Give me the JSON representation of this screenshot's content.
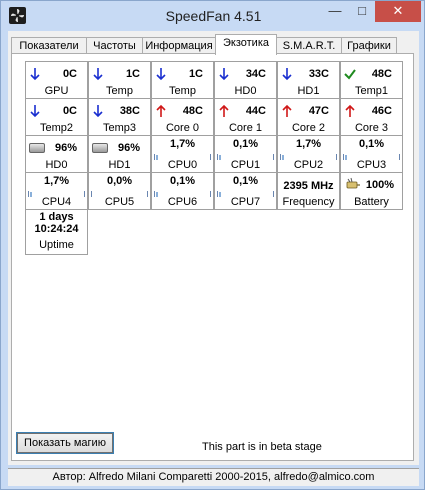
{
  "window": {
    "title": "SpeedFan 4.51",
    "minimize": "—",
    "maximize": "□",
    "close": "✕"
  },
  "tabs": [
    {
      "label": "Показатели"
    },
    {
      "label": "Частоты"
    },
    {
      "label": "Информация"
    },
    {
      "label": "Экзотика",
      "active": true
    },
    {
      "label": "S.M.A.R.T."
    },
    {
      "label": "Графики"
    }
  ],
  "sensors": {
    "gpu": {
      "value": "0C",
      "label": "GPU",
      "trend": "down"
    },
    "temp1": {
      "value": "1C",
      "label": "Temp",
      "trend": "down"
    },
    "temp2": {
      "value": "1C",
      "label": "Temp",
      "trend": "down"
    },
    "hd0": {
      "value": "34C",
      "label": "HD0",
      "trend": "down"
    },
    "hd1": {
      "value": "33C",
      "label": "HD1",
      "trend": "down"
    },
    "temp1b": {
      "value": "48C",
      "label": "Temp1",
      "trend": "ok"
    },
    "temp2b": {
      "value": "0C",
      "label": "Temp2",
      "trend": "down"
    },
    "temp3": {
      "value": "38C",
      "label": "Temp3",
      "trend": "down"
    },
    "core0": {
      "value": "48C",
      "label": "Core 0",
      "trend": "up"
    },
    "core1": {
      "value": "44C",
      "label": "Core 1",
      "trend": "up"
    },
    "core2": {
      "value": "47C",
      "label": "Core 2",
      "trend": "up"
    },
    "core3": {
      "value": "46C",
      "label": "Core 3",
      "trend": "up"
    }
  },
  "disks": {
    "hd0": {
      "value": "96%",
      "label": "HD0"
    },
    "hd1": {
      "value": "96%",
      "label": "HD1"
    }
  },
  "cpus": [
    {
      "value": "1,7%",
      "label": "CPU0"
    },
    {
      "value": "0,1%",
      "label": "CPU1"
    },
    {
      "value": "1,7%",
      "label": "CPU2"
    },
    {
      "value": "0,1%",
      "label": "CPU3"
    },
    {
      "value": "1,7%",
      "label": "CPU4"
    },
    {
      "value": "0,0%",
      "label": "CPU5"
    },
    {
      "value": "0,1%",
      "label": "CPU6"
    },
    {
      "value": "0,1%",
      "label": "CPU7"
    }
  ],
  "frequency": {
    "value": "2395 MHz",
    "label": "Frequency"
  },
  "battery": {
    "value": "100%",
    "label": "Battery"
  },
  "uptime": {
    "line1": "1 days",
    "line2": "10:24:24",
    "label": "Uptime"
  },
  "magic_button": "Показать магию",
  "beta_note": "This part is in beta stage",
  "status": "Автор: Alfredo Milani Comparetti 2000-2015, alfredo@almico.com",
  "colors": {
    "down": "#1a2fd0",
    "up": "#d01818",
    "ok": "#1f8a1f"
  }
}
